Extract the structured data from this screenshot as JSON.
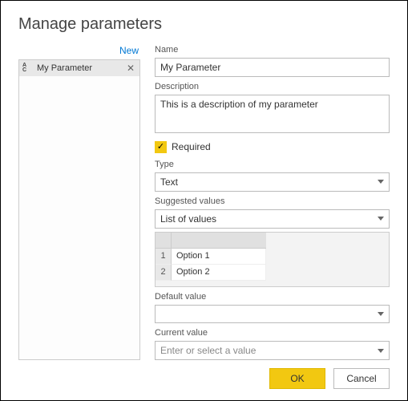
{
  "title": "Manage parameters",
  "sidebar": {
    "new_label": "New",
    "items": [
      {
        "label": "My Parameter"
      }
    ]
  },
  "labels": {
    "name": "Name",
    "description": "Description",
    "required": "Required",
    "type": "Type",
    "suggested": "Suggested values",
    "default": "Default value",
    "current": "Current value"
  },
  "fields": {
    "name": "My Parameter",
    "description": "This is a description of my parameter",
    "required_checked": true,
    "type_selected": "Text",
    "suggested_selected": "List of values",
    "list_values": [
      "Option 1",
      "Option 2"
    ],
    "default_selected": "",
    "current_placeholder": "Enter or select a value"
  },
  "buttons": {
    "ok": "OK",
    "cancel": "Cancel"
  }
}
